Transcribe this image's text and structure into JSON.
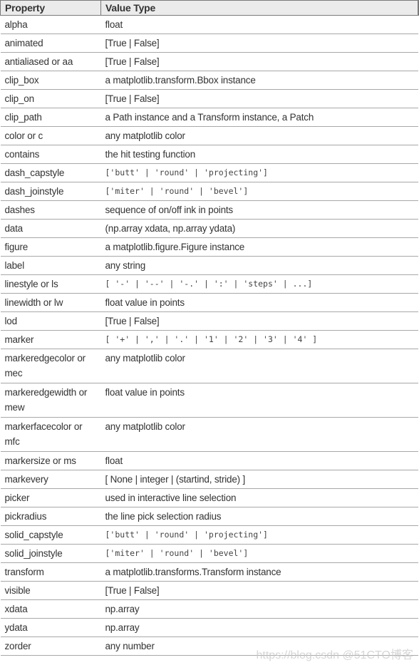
{
  "table": {
    "headers": {
      "property": "Property",
      "value_type": "Value Type"
    },
    "rows": [
      {
        "property": "alpha",
        "value": "float"
      },
      {
        "property": "animated",
        "value": "[True | False]"
      },
      {
        "property": "antialiased or aa",
        "value": "[True | False]"
      },
      {
        "property": "clip_box",
        "value": "a matplotlib.transform.Bbox instance"
      },
      {
        "property": "clip_on",
        "value": "[True | False]"
      },
      {
        "property": "clip_path",
        "value": "a Path instance and a Transform instance, a Patch"
      },
      {
        "property": "color or c",
        "value": "any matplotlib color"
      },
      {
        "property": "contains",
        "value": "the hit testing function"
      },
      {
        "property": "dash_capstyle",
        "value": "['butt' | 'round' | 'projecting']"
      },
      {
        "property": "dash_joinstyle",
        "value": "['miter' | 'round' | 'bevel']"
      },
      {
        "property": "dashes",
        "value": "sequence of on/off ink in points"
      },
      {
        "property": "data",
        "value": "(np.array xdata, np.array ydata)"
      },
      {
        "property": "figure",
        "value": "a matplotlib.figure.Figure instance"
      },
      {
        "property": "label",
        "value": "any string"
      },
      {
        "property": "linestyle or ls",
        "value": "[ '-' | '--' | '-.' | ':' | 'steps' | ...]"
      },
      {
        "property": "linewidth or lw",
        "value": "float value in points"
      },
      {
        "property": "lod",
        "value": "[True | False]"
      },
      {
        "property": "marker",
        "value": "[ '+' | ',' | '.' | '1' | '2' | '3' | '4' ]"
      },
      {
        "property": "markeredgecolor or mec",
        "value": "any matplotlib color"
      },
      {
        "property": "markeredgewidth or mew",
        "value": "float value in points"
      },
      {
        "property": "markerfacecolor or mfc",
        "value": "any matplotlib color"
      },
      {
        "property": "markersize or ms",
        "value": "float"
      },
      {
        "property": "markevery",
        "value": "[ None | integer | (startind, stride) ]"
      },
      {
        "property": "picker",
        "value": "used in interactive line selection"
      },
      {
        "property": "pickradius",
        "value": "the line pick selection radius"
      },
      {
        "property": "solid_capstyle",
        "value": "['butt' | 'round' | 'projecting']"
      },
      {
        "property": "solid_joinstyle",
        "value": "['miter' | 'round' | 'bevel']"
      },
      {
        "property": "transform",
        "value": "a matplotlib.transforms.Transform instance"
      },
      {
        "property": "visible",
        "value": "[True | False]"
      },
      {
        "property": "xdata",
        "value": "np.array"
      },
      {
        "property": "ydata",
        "value": "np.array"
      },
      {
        "property": "zorder",
        "value": "any number"
      }
    ]
  },
  "watermark": "https://blog.csdn @51CTO博客"
}
